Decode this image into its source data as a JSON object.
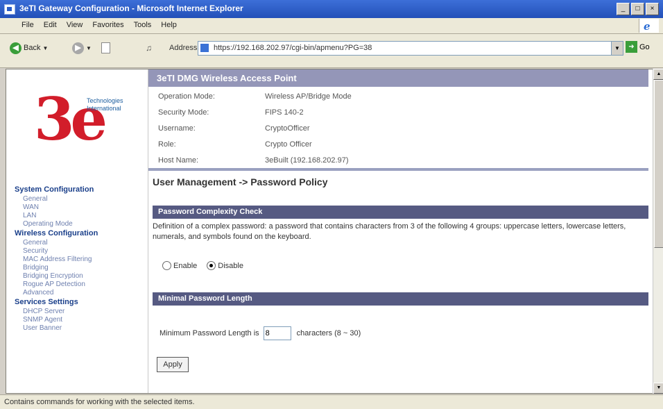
{
  "window": {
    "title": "3eTI Gateway Configuration - Microsoft Internet Explorer",
    "min": "_",
    "max": "□",
    "close": "×"
  },
  "menu": [
    "File",
    "Edit",
    "View",
    "Favorites",
    "Tools",
    "Help"
  ],
  "toolbar": {
    "back": "Back",
    "address_label": "Address",
    "url": "https://192.168.202.97/cgi-bin/apmenu?PG=38",
    "go": "Go"
  },
  "logo": {
    "mark": "3e",
    "tagline": "Technologies International"
  },
  "nav": [
    {
      "section": "System Configuration",
      "items": [
        "General",
        "WAN",
        "LAN",
        "Operating Mode"
      ]
    },
    {
      "section": "Wireless Configuration",
      "items": [
        "General",
        "Security",
        "MAC Address Filtering",
        "Bridging",
        "Bridging Encryption",
        "Rogue AP Detection",
        "Advanced"
      ]
    },
    {
      "section": "Services Settings",
      "items": [
        "DHCP Server",
        "SNMP Agent",
        "User Banner"
      ]
    }
  ],
  "header": {
    "banner": "3eTI DMG Wireless Access Point",
    "info": [
      {
        "label": "Operation Mode:",
        "value": "Wireless AP/Bridge Mode"
      },
      {
        "label": "Security Mode:",
        "value": "FIPS 140-2"
      },
      {
        "label": "Username:",
        "value": "CryptoOfficer"
      },
      {
        "label": "Role:",
        "value": "Crypto Officer"
      },
      {
        "label": "Host Name:",
        "value": "3eBuilt (192.168.202.97)"
      }
    ]
  },
  "page": {
    "title": "User Management -> Password Policy",
    "complexity_header": "Password Complexity Check",
    "complexity_desc": "Definition of a complex password: a password that contains characters from 3 of the following 4 groups: uppercase letters, lowercase letters, numerals, and symbols found on the keyboard.",
    "enable_label": "Enable",
    "disable_label": "Disable",
    "selected": "disable",
    "min_header": "Minimal Password Length",
    "min_label": "Minimum Password Length is",
    "min_value": "8",
    "min_suffix": "characters (8 ~ 30)",
    "apply": "Apply"
  },
  "status": "Contains commands for working with the selected items."
}
